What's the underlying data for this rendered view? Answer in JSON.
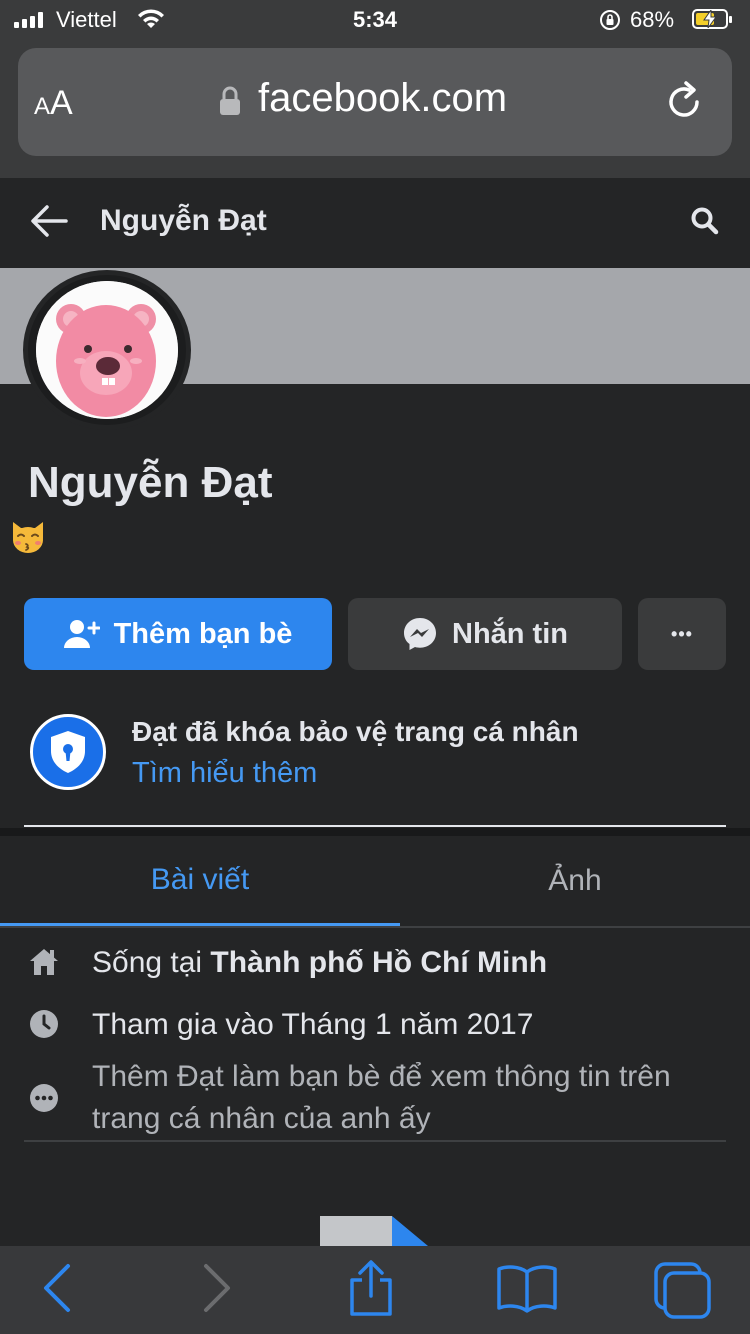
{
  "status_bar": {
    "carrier": "Viettel",
    "time": "5:34",
    "battery_percent": "68%",
    "battery_level": 0.68
  },
  "browser": {
    "text_size_label": "AA",
    "url": "facebook.com"
  },
  "header": {
    "title": "Nguyễn Đạt"
  },
  "profile": {
    "name": "Nguyễn Đạt",
    "bio_emoji": "kissing-cat-emoji"
  },
  "actions": {
    "add_friend_label": "Thêm bạn bè",
    "message_label": "Nhắn tin",
    "more_label": "•••"
  },
  "profile_lock": {
    "title": "Đạt đã khóa bảo vệ trang cá nhân",
    "learn_more": "Tìm hiểu thêm"
  },
  "tabs": [
    {
      "label": "Bài viết",
      "active": true
    },
    {
      "label": "Ảnh",
      "active": false
    }
  ],
  "about": {
    "lives_in_prefix": "Sống tại ",
    "lives_in_city": "Thành phố Hồ Chí Minh",
    "joined": "Tham gia vào Tháng 1 năm 2017",
    "more_info": "Thêm Đạt làm bạn bè để xem thông tin trên trang cá nhân của anh ấy"
  },
  "colors": {
    "accent": "#2d86ee",
    "link": "#4599f3",
    "background": "#242526",
    "button_secondary": "#3a3b3c"
  }
}
